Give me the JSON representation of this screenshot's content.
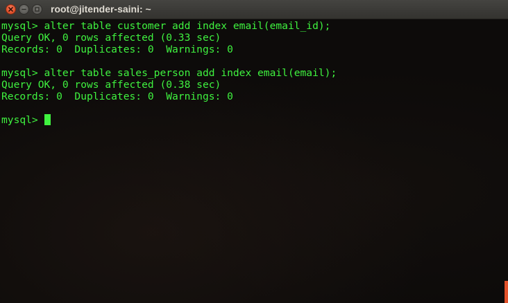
{
  "window": {
    "title": "root@jitender-saini: ~"
  },
  "colors": {
    "text": "#3ff23f",
    "background": "#0d0b0a",
    "titlebar": "#3c3b37",
    "close_button": "#e2522b"
  },
  "terminal": {
    "lines": [
      "mysql> alter table customer add index email(email_id);",
      "Query OK, 0 rows affected (0.33 sec)",
      "Records: 0  Duplicates: 0  Warnings: 0",
      "",
      "mysql> alter table sales_person add index email(email);",
      "Query OK, 0 rows affected (0.38 sec)",
      "Records: 0  Duplicates: 0  Warnings: 0",
      ""
    ],
    "prompt": "mysql> "
  }
}
